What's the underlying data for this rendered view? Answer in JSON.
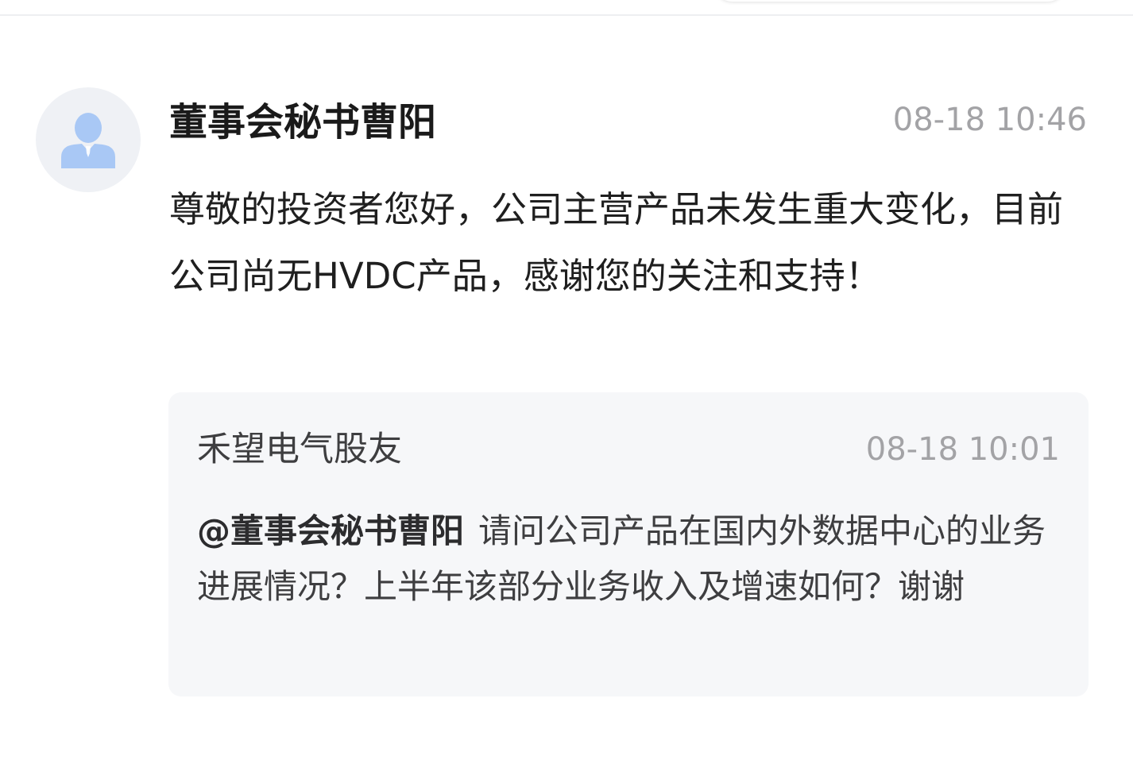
{
  "post": {
    "author": "董事会秘书曹阳",
    "time": "08-18 10:46",
    "content": "尊敬的投资者您好，公司主营产品未发生重大变化，目前公司尚无HVDC产品，感谢您的关注和支持！"
  },
  "quote": {
    "author": "禾望电气股友",
    "time": "08-18 10:01",
    "mention": "@董事会秘书曹阳",
    "content": "请问公司产品在国内外数据中心的业务进展情况？上半年该部分业务收入及增速如何？谢谢"
  },
  "icons": {
    "avatar": "person-icon"
  },
  "colors": {
    "avatar_bg": "#eff1f5",
    "avatar_figure": "#a9c8f5",
    "quote_bg": "#f6f7f9",
    "time": "#a3a3a6"
  }
}
